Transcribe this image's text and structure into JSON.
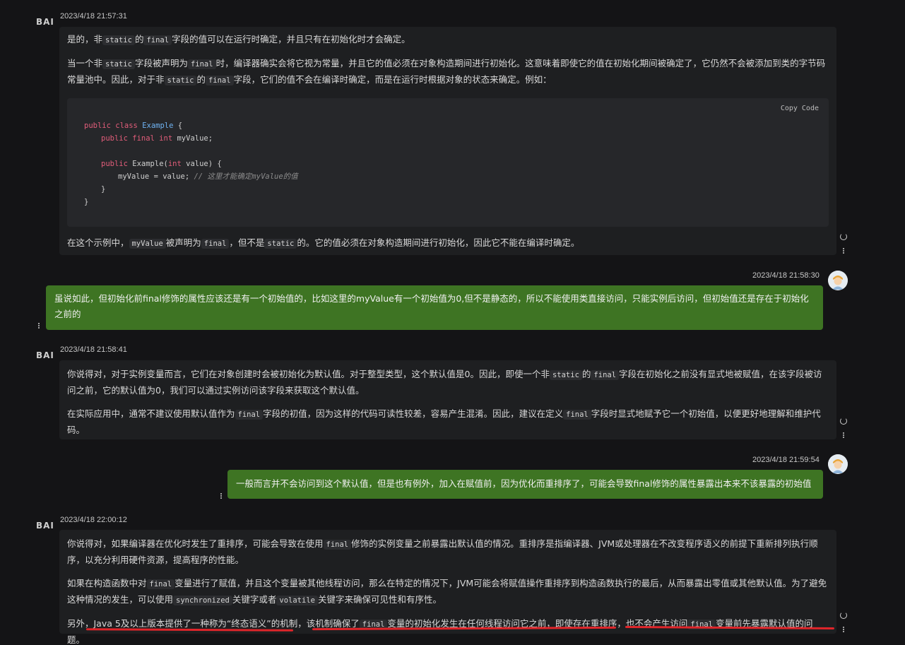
{
  "bot_logo": "BAI",
  "code": {
    "copy_label": "Copy Code",
    "l1_kw": "public class",
    "l1_cls": "Example",
    "l1_rest": " {",
    "l2_kw": "public final int",
    "l2_rest": " myValue;",
    "l4_kw": "public",
    "l4_a": " Example(",
    "l4_kw2": "int",
    "l4_b": " value) {",
    "l5_rest": "myValue = value;  ",
    "l5_cm": "// 这里才能确定myValue的值",
    "l6": "}",
    "l7": "}"
  },
  "msgs": {
    "m1": {
      "time": "2023/4/18 21:57:31",
      "p1": [
        "是的，非",
        "static",
        "的",
        "final",
        "字段的值可以在运行时确定，并且只有在初始化时才会确定。"
      ],
      "p2": [
        "当一个非",
        "static",
        "字段被声明为",
        "final",
        "时，编译器确实会将它视为常量，并且它的值必须在对象构造期间进行初始化。这意味着即使它的值在初始化期间被确定了，它仍然不会被添加到类的字节码常量池中。因此，对于非",
        "static",
        "的",
        "final",
        "字段，它们的值不会在编译时确定，而是在运行时根据对象的状态来确定。例如："
      ],
      "p3": [
        "在这个示例中，",
        "myValue",
        "被声明为",
        "final",
        "，但不是",
        "static",
        "的。它的值必须在对象构造期间进行初始化，因此它不能在编译时确定。"
      ]
    },
    "m2": {
      "time": "2023/4/18 21:58:30",
      "text": "虽说如此，但初始化前final修饰的属性应该还是有一个初始值的，比如这里的myValue有一个初始值为0,但不是静态的，所以不能使用类直接访问，只能实例后访问，但初始值还是存在于初始化之前的"
    },
    "m3": {
      "time": "2023/4/18 21:58:41",
      "p1": [
        "你说得对，对于实例变量而言，它们在对象创建时会被初始化为默认值。对于整型类型，这个默认值是0。因此，即使一个非",
        "static",
        "的",
        "final",
        "字段在初始化之前没有显式地被赋值，在该字段被访问之前，它的默认值为0，我们可以通过实例访问该字段来获取这个默认值。"
      ],
      "p2": [
        "在实际应用中，通常不建议使用默认值作为",
        "final",
        "字段的初值，因为这样的代码可读性较差，容易产生混淆。因此，建议在定义",
        "final",
        "字段时显式地赋予它一个初始值，以便更好地理解和维护代码。"
      ]
    },
    "m4": {
      "time": "2023/4/18 21:59:54",
      "text": "一般而言并不会访问到这个默认值，但是也有例外，加入在赋值前，因为优化而重排序了，可能会导致final修饰的属性暴露出本来不该暴露的初始值"
    },
    "m5": {
      "time": "2023/4/18 22:00:12",
      "p1": [
        "你说得对，如果编译器在优化时发生了重排序，可能会导致在使用",
        "final",
        "修饰的实例变量之前暴露出默认值的情况。重排序是指编译器、JVM或处理器在不改变程序语义的前提下重新排列执行顺序，以充分利用硬件资源，提高程序的性能。"
      ],
      "p2": [
        "如果在构造函数中对",
        "final",
        "变量进行了赋值，并且这个变量被其他线程访问，那么在特定的情况下，JVM可能会将赋值操作重排序到构造函数执行的最后，从而暴露出零值或其他默认值。为了避免这种情况的发生，可以使用",
        "synchronized",
        "关键字或者",
        "volatile",
        "关键字来确保可见性和有序性。"
      ],
      "p3": [
        "另外，Java 5及以上版本提供了一种称为“终态语义”的机制，该机制确保了",
        "final",
        "变量的初始化发生在任何线程访问它之前，即使存在重排序，也不会产生访问",
        "final",
        "变量前先暴露默认值的问题。"
      ]
    }
  }
}
